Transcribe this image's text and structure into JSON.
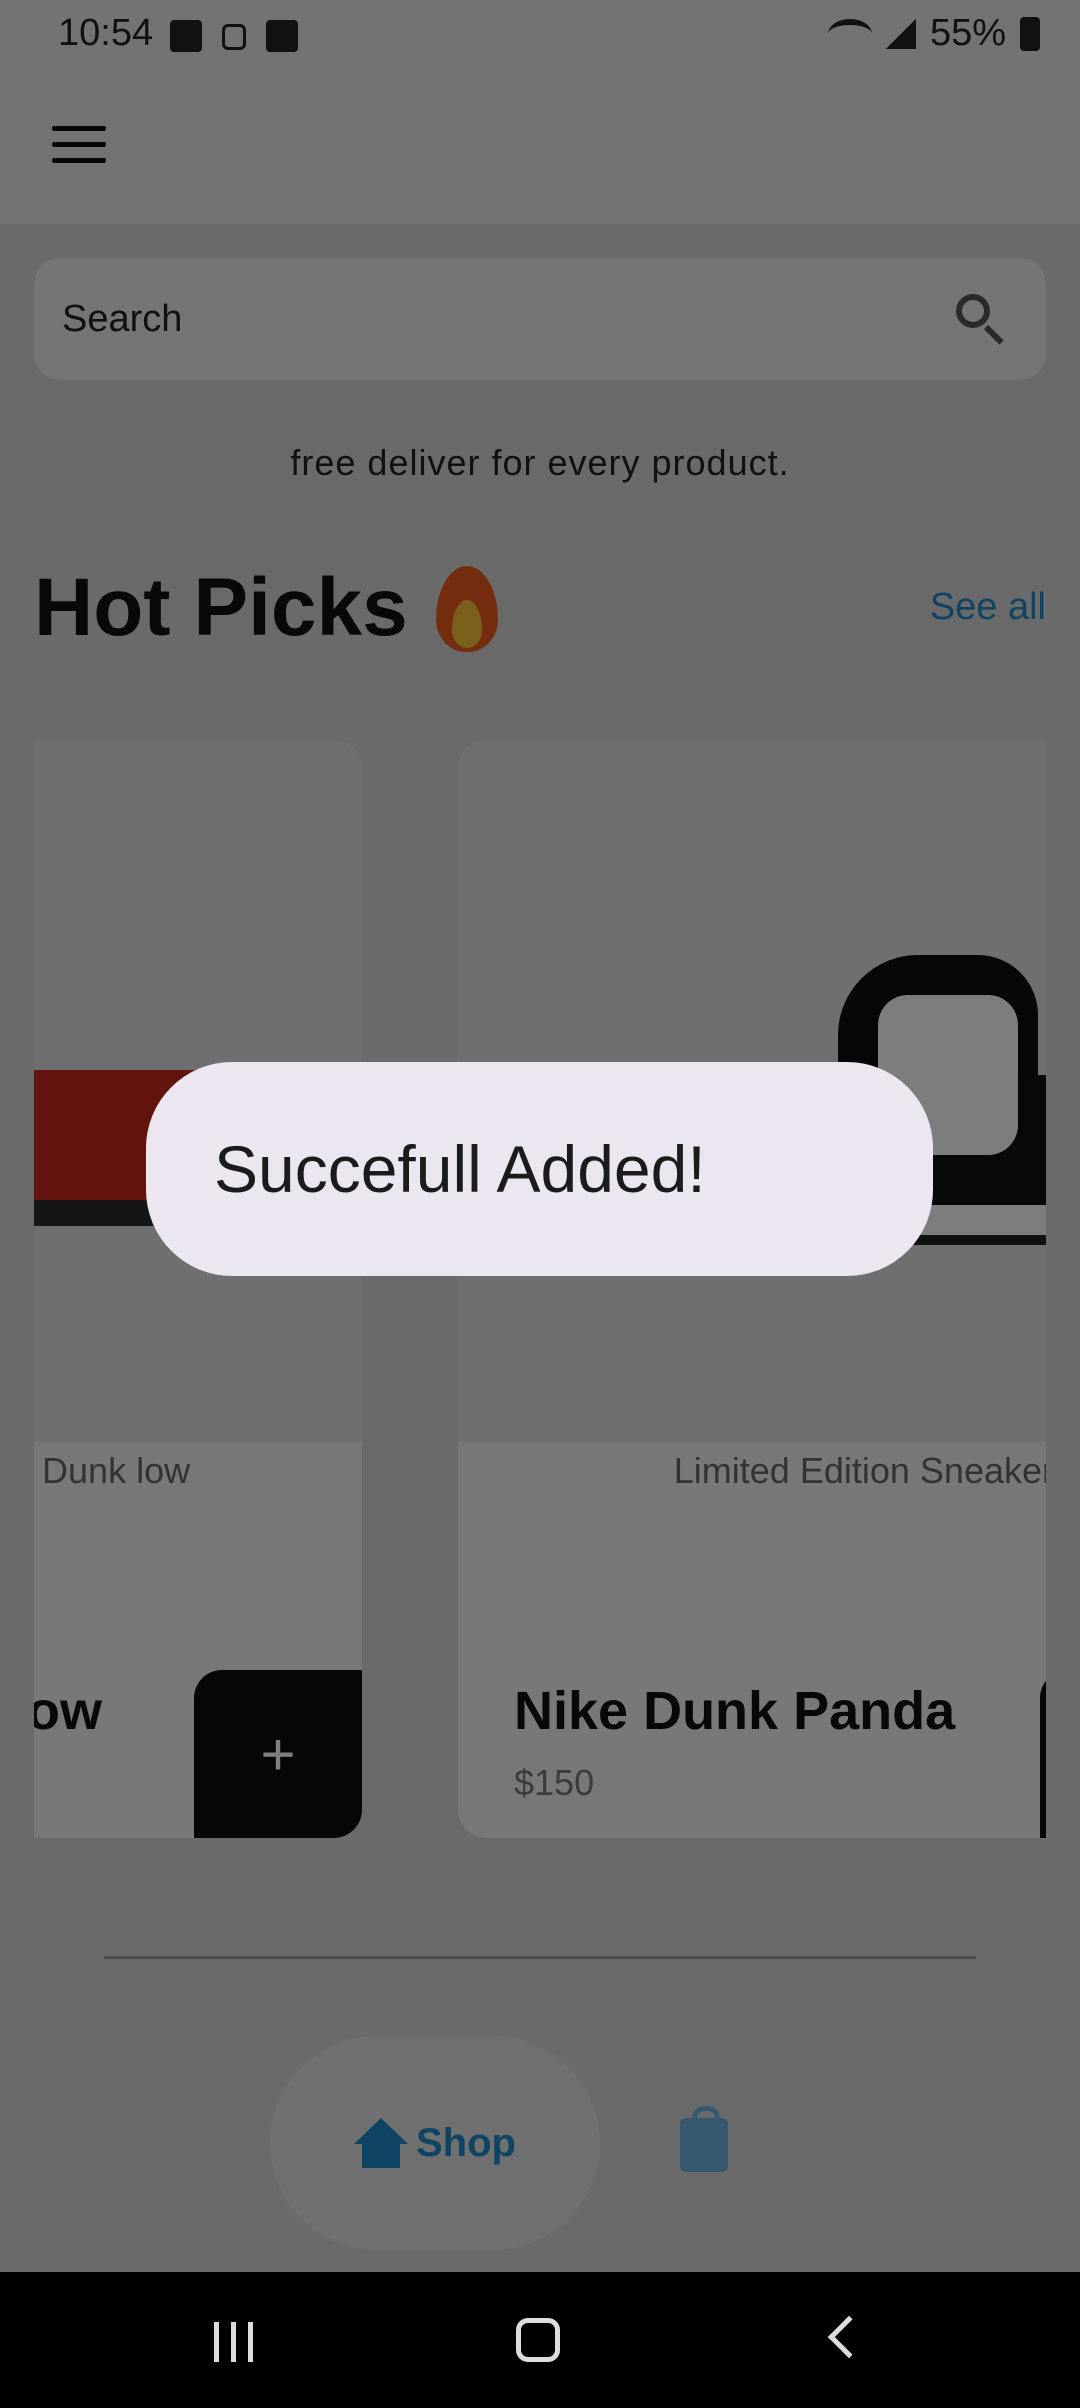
{
  "status_bar": {
    "time": "10:54",
    "battery": "55%"
  },
  "search": {
    "placeholder": "Search"
  },
  "promo_text": "free deliver for every product.",
  "section": {
    "title": "Hot Picks",
    "see_all": "See all"
  },
  "products": [
    {
      "description": "ke Dunk low",
      "name": "Low",
      "add_label": "+"
    },
    {
      "description": "Limited Edition Sneaker",
      "name": "Nike Dunk Panda",
      "price": "$150"
    }
  ],
  "toast": {
    "message": "Succefull Added!"
  },
  "bottom_nav": {
    "shop_label": "Shop"
  },
  "colors": {
    "accent": "#1e88c9",
    "toast_bg": "#ece6f1",
    "button_dark": "#0c0c0c"
  }
}
